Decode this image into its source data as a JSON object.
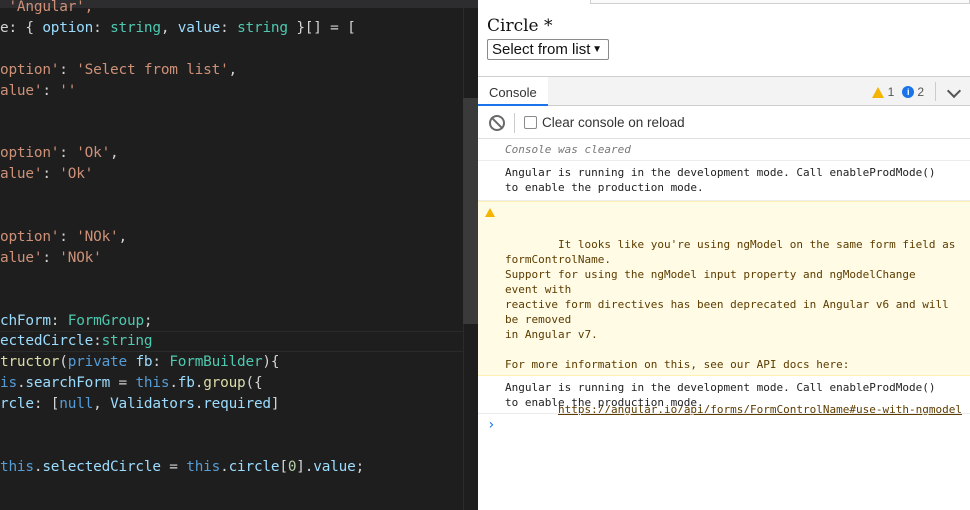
{
  "editor": {
    "lines": [
      [
        {
          "c": "tk-str",
          "t": " 'Angular',"
        }
      ],
      [
        {
          "c": "tk-plain",
          "t": "e: { "
        },
        {
          "c": "tk-key",
          "t": "option"
        },
        {
          "c": "tk-plain",
          "t": ": "
        },
        {
          "c": "tk-type",
          "t": "string"
        },
        {
          "c": "tk-plain",
          "t": ", "
        },
        {
          "c": "tk-key",
          "t": "value"
        },
        {
          "c": "tk-plain",
          "t": ": "
        },
        {
          "c": "tk-type",
          "t": "string"
        },
        {
          "c": "tk-plain",
          "t": " }[] = ["
        }
      ],
      [],
      [
        {
          "c": "tk-str",
          "t": "option'"
        },
        {
          "c": "tk-plain",
          "t": ": "
        },
        {
          "c": "tk-str",
          "t": "'Select from list'"
        },
        {
          "c": "tk-plain",
          "t": ","
        }
      ],
      [
        {
          "c": "tk-str",
          "t": "alue'"
        },
        {
          "c": "tk-plain",
          "t": ": "
        },
        {
          "c": "tk-str",
          "t": "''"
        }
      ],
      [],
      [],
      [
        {
          "c": "tk-str",
          "t": "option'"
        },
        {
          "c": "tk-plain",
          "t": ": "
        },
        {
          "c": "tk-str",
          "t": "'Ok'"
        },
        {
          "c": "tk-plain",
          "t": ","
        }
      ],
      [
        {
          "c": "tk-str",
          "t": "alue'"
        },
        {
          "c": "tk-plain",
          "t": ": "
        },
        {
          "c": "tk-str",
          "t": "'Ok'"
        }
      ],
      [],
      [],
      [
        {
          "c": "tk-str",
          "t": "option'"
        },
        {
          "c": "tk-plain",
          "t": ": "
        },
        {
          "c": "tk-str",
          "t": "'NOk'"
        },
        {
          "c": "tk-plain",
          "t": ","
        }
      ],
      [
        {
          "c": "tk-str",
          "t": "alue'"
        },
        {
          "c": "tk-plain",
          "t": ": "
        },
        {
          "c": "tk-str",
          "t": "'NOk'"
        }
      ],
      [],
      [],
      [
        {
          "c": "tk-key",
          "t": "chForm"
        },
        {
          "c": "tk-plain",
          "t": ": "
        },
        {
          "c": "tk-type",
          "t": "FormGroup"
        },
        {
          "c": "tk-plain",
          "t": ";"
        }
      ],
      [
        {
          "c": "tk-key",
          "t": "ectedCircle"
        },
        {
          "c": "tk-plain",
          "t": ":"
        },
        {
          "c": "tk-type",
          "t": "string"
        }
      ],
      [
        {
          "c": "tk-fn",
          "t": "tructor"
        },
        {
          "c": "tk-plain",
          "t": "("
        },
        {
          "c": "tk-kw",
          "t": "private"
        },
        {
          "c": "tk-plain",
          "t": " "
        },
        {
          "c": "tk-key",
          "t": "fb"
        },
        {
          "c": "tk-plain",
          "t": ": "
        },
        {
          "c": "tk-type",
          "t": "FormBuilder"
        },
        {
          "c": "tk-plain",
          "t": "){"
        }
      ],
      [
        {
          "c": "tk-kw",
          "t": "is"
        },
        {
          "c": "tk-plain",
          "t": "."
        },
        {
          "c": "tk-key",
          "t": "searchForm"
        },
        {
          "c": "tk-plain",
          "t": " = "
        },
        {
          "c": "tk-kw",
          "t": "this"
        },
        {
          "c": "tk-plain",
          "t": "."
        },
        {
          "c": "tk-key",
          "t": "fb"
        },
        {
          "c": "tk-plain",
          "t": "."
        },
        {
          "c": "tk-fn",
          "t": "group"
        },
        {
          "c": "tk-plain",
          "t": "({"
        }
      ],
      [
        {
          "c": "tk-key",
          "t": "rcle"
        },
        {
          "c": "tk-plain",
          "t": ": ["
        },
        {
          "c": "tk-kw",
          "t": "null"
        },
        {
          "c": "tk-plain",
          "t": ", "
        },
        {
          "c": "tk-key",
          "t": "Validators"
        },
        {
          "c": "tk-plain",
          "t": "."
        },
        {
          "c": "tk-key",
          "t": "required"
        },
        {
          "c": "tk-plain",
          "t": "]"
        }
      ],
      [],
      [],
      [
        {
          "c": "tk-kw",
          "t": "this"
        },
        {
          "c": "tk-plain",
          "t": "."
        },
        {
          "c": "tk-key",
          "t": "selectedCircle"
        },
        {
          "c": "tk-plain",
          "t": " = "
        },
        {
          "c": "tk-kw",
          "t": "this"
        },
        {
          "c": "tk-plain",
          "t": "."
        },
        {
          "c": "tk-key",
          "t": "circle"
        },
        {
          "c": "tk-plain",
          "t": "["
        },
        {
          "c": "tk-num",
          "t": "0"
        },
        {
          "c": "tk-plain",
          "t": "]."
        },
        {
          "c": "tk-key",
          "t": "value"
        },
        {
          "c": "tk-plain",
          "t": ";"
        }
      ]
    ]
  },
  "page": {
    "field_label": "Circle *",
    "select_value": "Select from list",
    "select_arrow": "▼"
  },
  "devtools": {
    "tab_label": "Console",
    "warning_count": "1",
    "info_count": "2",
    "info_glyph": "i",
    "clear_on_reload_label": "Clear console on reload",
    "messages": {
      "cleared": "Console was cleared",
      "angular_dev_1": "Angular is running in the development mode. Call enableProdMode()\nto enable the production mode.",
      "warning_body": "It looks like you're using ngModel on the same form field as\nformControlName.\nSupport for using the ngModel input property and ngModelChange\nevent with\nreactive form directives has been deprecated in Angular v6 and will\nbe removed\nin Angular v7.\n\nFor more information on this, see our API docs here:",
      "warning_link": "https://angular.io/api/forms/FormControlName#use-with-ngmodel",
      "angular_dev_2": "Angular is running in the development mode. Call enableProdMode()\nto enable the production mode."
    },
    "prompt_glyph": "›"
  }
}
